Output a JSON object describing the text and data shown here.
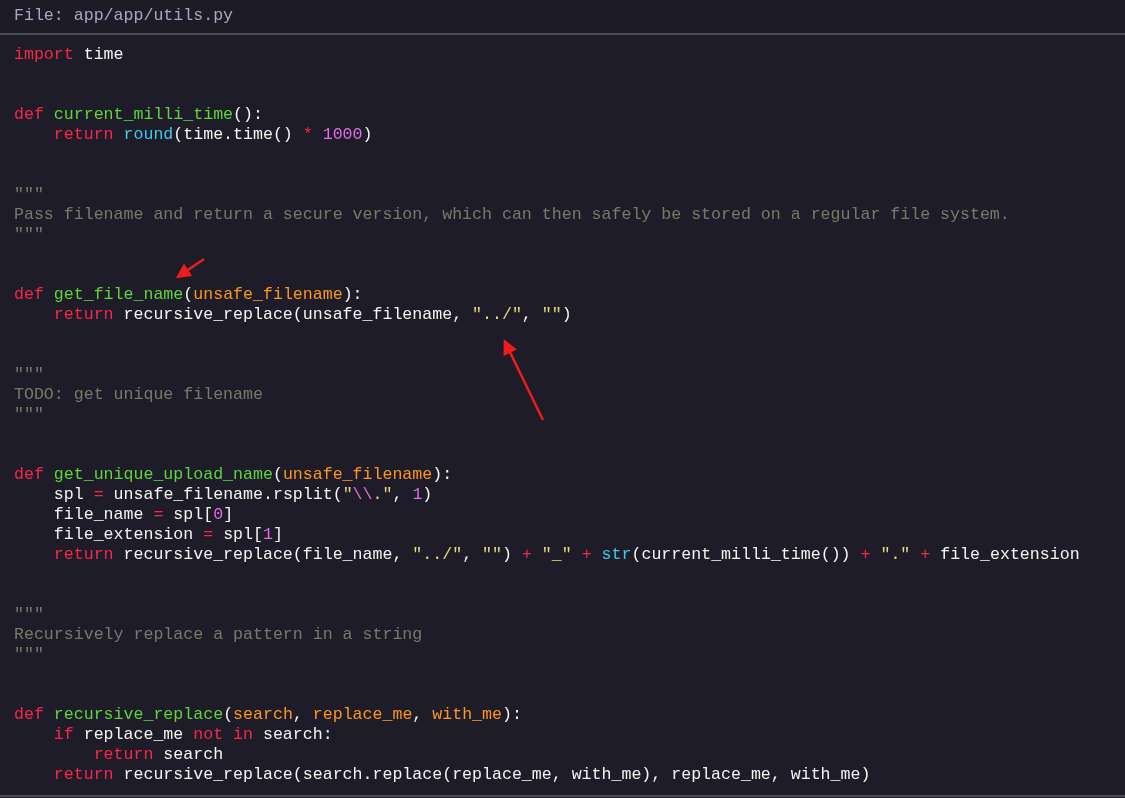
{
  "header": {
    "file_path": "File: app/app/utils.py"
  },
  "blocks": [
    {
      "lines": [
        {
          "tokens": [
            {
              "kind": "keyword",
              "text": "import"
            },
            {
              "kind": "plain",
              "text": " time"
            }
          ]
        }
      ]
    },
    {
      "lines": [
        {
          "tokens": [
            {
              "kind": "keyword",
              "text": "def"
            },
            {
              "kind": "function",
              "text": " current_milli_time"
            },
            {
              "kind": "plain",
              "text": "():"
            }
          ],
          "children": [
            {
              "tokens": [
                {
                  "kind": "keyword",
                  "text": "return"
                },
                {
                  "kind": "builtin",
                  "text": " round"
                },
                {
                  "kind": "plain",
                  "text": "(time.time() "
                },
                {
                  "kind": "keyword",
                  "text": "*"
                },
                {
                  "kind": "number",
                  "text": " 1000"
                },
                {
                  "kind": "plain",
                  "text": ")"
                }
              ]
            }
          ]
        }
      ]
    },
    {
      "lines": [
        {
          "tokens": [
            {
              "kind": "comment",
              "text": "\"\"\""
            }
          ]
        },
        {
          "tokens": [
            {
              "kind": "comment",
              "text": "Pass filename and return a secure version, which can then safely be stored on a regular file system."
            }
          ]
        },
        {
          "tokens": [
            {
              "kind": "comment",
              "text": "\"\"\""
            }
          ]
        }
      ]
    },
    {
      "lines": [
        {
          "tokens": [
            {
              "kind": "keyword",
              "text": "def"
            },
            {
              "kind": "function",
              "text": " get_file_name"
            },
            {
              "kind": "plain",
              "text": "("
            },
            {
              "kind": "param",
              "text": "unsafe_filename"
            },
            {
              "kind": "plain",
              "text": "):"
            }
          ],
          "children": [
            {
              "tokens": [
                {
                  "kind": "keyword",
                  "text": "return"
                },
                {
                  "kind": "plain",
                  "text": " recursive_replace(unsafe_filename, "
                },
                {
                  "kind": "string",
                  "text": "\"../\""
                },
                {
                  "kind": "plain",
                  "text": ", "
                },
                {
                  "kind": "string",
                  "text": "\"\""
                },
                {
                  "kind": "plain",
                  "text": ")"
                }
              ]
            }
          ]
        }
      ]
    },
    {
      "lines": [
        {
          "tokens": [
            {
              "kind": "comment",
              "text": "\"\"\""
            }
          ]
        },
        {
          "tokens": [
            {
              "kind": "comment",
              "text": "TODO: get unique filename"
            }
          ]
        },
        {
          "tokens": [
            {
              "kind": "comment",
              "text": "\"\"\""
            }
          ]
        }
      ]
    },
    {
      "lines": [
        {
          "tokens": [
            {
              "kind": "keyword",
              "text": "def"
            },
            {
              "kind": "function",
              "text": " get_unique_upload_name"
            },
            {
              "kind": "plain",
              "text": "("
            },
            {
              "kind": "param",
              "text": "unsafe_filename"
            },
            {
              "kind": "plain",
              "text": "):"
            }
          ],
          "children": [
            {
              "tokens": [
                {
                  "kind": "plain",
                  "text": "spl "
                },
                {
                  "kind": "keyword",
                  "text": "="
                },
                {
                  "kind": "plain",
                  "text": " unsafe_filename.rsplit("
                },
                {
                  "kind": "string",
                  "text": "\""
                },
                {
                  "kind": "number",
                  "text": "\\\\"
                },
                {
                  "kind": "string",
                  "text": ".\""
                },
                {
                  "kind": "plain",
                  "text": ", "
                },
                {
                  "kind": "number",
                  "text": "1"
                },
                {
                  "kind": "plain",
                  "text": ")"
                }
              ]
            },
            {
              "tokens": [
                {
                  "kind": "plain",
                  "text": "file_name "
                },
                {
                  "kind": "keyword",
                  "text": "="
                },
                {
                  "kind": "plain",
                  "text": " spl["
                },
                {
                  "kind": "number",
                  "text": "0"
                },
                {
                  "kind": "plain",
                  "text": "]"
                }
              ]
            },
            {
              "tokens": [
                {
                  "kind": "plain",
                  "text": "file_extension "
                },
                {
                  "kind": "keyword",
                  "text": "="
                },
                {
                  "kind": "plain",
                  "text": " spl["
                },
                {
                  "kind": "number",
                  "text": "1"
                },
                {
                  "kind": "plain",
                  "text": "]"
                }
              ]
            },
            {
              "tokens": [
                {
                  "kind": "keyword",
                  "text": "return"
                },
                {
                  "kind": "plain",
                  "text": " recursive_replace(file_name, "
                },
                {
                  "kind": "string",
                  "text": "\"../\""
                },
                {
                  "kind": "plain",
                  "text": ", "
                },
                {
                  "kind": "string",
                  "text": "\"\""
                },
                {
                  "kind": "plain",
                  "text": ") "
                },
                {
                  "kind": "keyword",
                  "text": "+"
                },
                {
                  "kind": "string",
                  "text": " \"_\" "
                },
                {
                  "kind": "keyword",
                  "text": "+"
                },
                {
                  "kind": "builtin",
                  "text": " str"
                },
                {
                  "kind": "plain",
                  "text": "(current_milli_time()) "
                },
                {
                  "kind": "keyword",
                  "text": "+"
                },
                {
                  "kind": "string",
                  "text": " \".\" "
                },
                {
                  "kind": "keyword",
                  "text": "+"
                },
                {
                  "kind": "plain",
                  "text": " file_extension"
                }
              ]
            }
          ]
        }
      ]
    },
    {
      "lines": [
        {
          "tokens": [
            {
              "kind": "comment",
              "text": "\"\"\""
            }
          ]
        },
        {
          "tokens": [
            {
              "kind": "comment",
              "text": "Recursively replace a pattern in a string"
            }
          ]
        },
        {
          "tokens": [
            {
              "kind": "comment",
              "text": "\"\"\""
            }
          ]
        }
      ]
    },
    {
      "lines": [
        {
          "tokens": [
            {
              "kind": "keyword",
              "text": "def"
            },
            {
              "kind": "function",
              "text": " recursive_replace"
            },
            {
              "kind": "plain",
              "text": "("
            },
            {
              "kind": "param",
              "text": "search"
            },
            {
              "kind": "plain",
              "text": ", "
            },
            {
              "kind": "param",
              "text": "replace_me"
            },
            {
              "kind": "plain",
              "text": ", "
            },
            {
              "kind": "param",
              "text": "with_me"
            },
            {
              "kind": "plain",
              "text": "):"
            }
          ],
          "children": [
            {
              "tokens": [
                {
                  "kind": "keyword",
                  "text": "if"
                },
                {
                  "kind": "plain",
                  "text": " replace_me "
                },
                {
                  "kind": "keyword",
                  "text": "not in"
                },
                {
                  "kind": "plain",
                  "text": " search:"
                }
              ],
              "children": [
                {
                  "tokens": [
                    {
                      "kind": "keyword",
                      "text": "return"
                    },
                    {
                      "kind": "plain",
                      "text": " search"
                    }
                  ]
                }
              ]
            },
            {
              "tokens": [
                {
                  "kind": "keyword",
                  "text": "return"
                },
                {
                  "kind": "plain",
                  "text": " recursive_replace(search.replace(replace_me, with_me), replace_me, with_me)"
                }
              ]
            }
          ]
        }
      ]
    }
  ]
}
